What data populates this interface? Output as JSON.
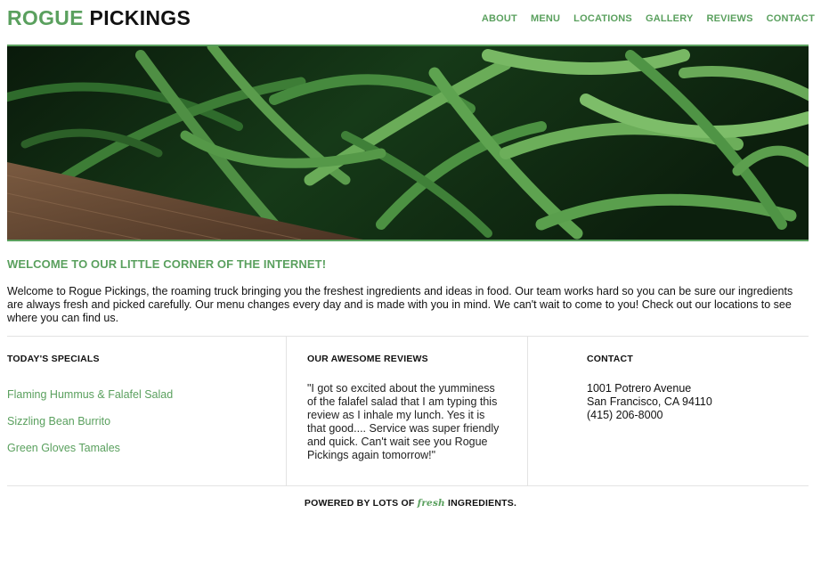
{
  "header": {
    "logo_green": "ROGUE",
    "logo_black": "PICKINGS",
    "nav": [
      "ABOUT",
      "MENU",
      "LOCATIONS",
      "GALLERY",
      "REVIEWS",
      "CONTACT"
    ]
  },
  "hero": {
    "image": "green-beans-photo"
  },
  "welcome": {
    "title": "WELCOME TO OUR LITTLE CORNER OF THE INTERNET!",
    "text": "Welcome to Rogue Pickings, the roaming truck bringing you the freshest ingredients and ideas in food. Our team works hard so you can be sure our ingredients are always fresh and picked carefully. Our menu changes every day and is made with you in mind. We can't wait to come to you! Check out our locations to see where you can find us."
  },
  "specials": {
    "title": "TODAY'S SPECIALS",
    "items": [
      "Flaming Hummus & Falafel Salad",
      "Sizzling Bean Burrito",
      "Green Gloves Tamales"
    ]
  },
  "reviews": {
    "title": "OUR AWESOME REVIEWS",
    "text": "\"I got so excited about the yumminess of the falafel salad that I am typing this review as I inhale my lunch. Yes it is that good.... Service was super friendly and quick. Can't wait see you Rogue Pickings again tomorrow!\""
  },
  "contact": {
    "title": "CONTACT",
    "address_line1": "1001 Potrero Avenue",
    "address_line2": "San Francisco, CA 94110",
    "phone": "(415) 206-8000"
  },
  "footer": {
    "prefix": "POWERED BY LOTS OF",
    "fresh": "fresh",
    "suffix": "INGREDIENTS."
  },
  "colors": {
    "accent": "#5aa05e",
    "text": "#111111",
    "divider": "#e3e3e3"
  }
}
